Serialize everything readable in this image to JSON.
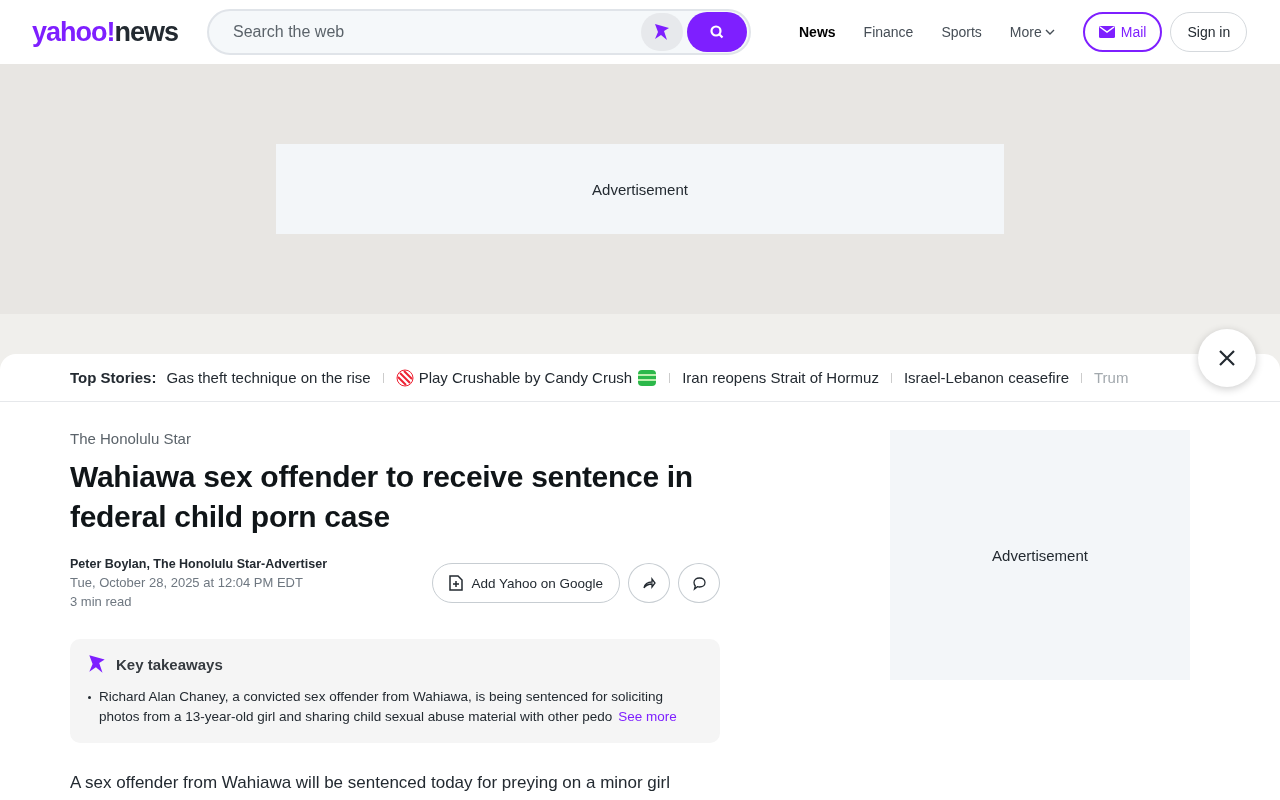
{
  "header": {
    "logo": {
      "brand": "yahoo!",
      "section": "news"
    },
    "search": {
      "placeholder": "Search the web"
    },
    "nav": [
      {
        "label": "News",
        "selected": true
      },
      {
        "label": "Finance",
        "selected": false
      },
      {
        "label": "Sports",
        "selected": false
      },
      {
        "label": "More",
        "selected": false,
        "dropdown": true
      }
    ],
    "mail_button": "Mail",
    "sign_in": "Sign in"
  },
  "top_ad": "Advertisement",
  "top_stories": {
    "label": "Top Stories:",
    "items": [
      {
        "text": "Gas theft technique on the rise",
        "kind": "plain"
      },
      {
        "text": "Play Crushable by Candy Crush",
        "kind": "promo"
      },
      {
        "text": "Iran reopens Strait of Hormuz",
        "kind": "plain"
      },
      {
        "text": "Israel-Lebanon ceasefire",
        "kind": "plain"
      },
      {
        "text": "Trum",
        "kind": "faded"
      }
    ]
  },
  "article": {
    "source": "The Honolulu Star",
    "title": "Wahiawa sex offender to receive sentence in federal child porn case",
    "byline": "Peter Boylan, The Honolulu Star-Advertiser",
    "date": "Tue, October 28, 2025 at 12:04 PM EDT",
    "read_time": "3 min read",
    "add_google": "Add Yahoo on Google",
    "takeaways": {
      "title": "Key takeaways",
      "items": [
        "Richard Alan Chaney, a convicted sex offender from Wahiawa, is being sentenced for soliciting photos from a 13-year-old girl and sharing child sexual abuse material with other pedo"
      ],
      "see_more": "See more"
    },
    "body": "A sex offender from Wahiawa will be sentenced today for preying on a minor girl"
  },
  "side_ad": "Advertisement"
}
